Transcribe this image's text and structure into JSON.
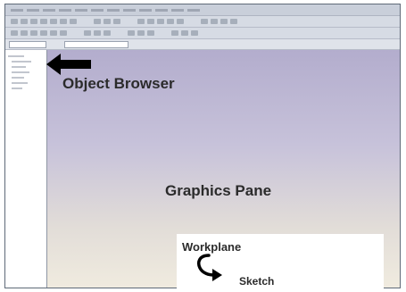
{
  "annotations": {
    "object_browser": "Object Browser",
    "graphics_pane": "Graphics Pane",
    "workplane": "Workplane",
    "sketch": "Sketch"
  },
  "icons": {
    "pointer": "arrow-left-icon",
    "transition": "curved-arrow-icon"
  },
  "colors": {
    "annotation_text": "#2b2b2b",
    "graphics_top": "#b3adcd",
    "graphics_bottom": "#f0ebdf"
  }
}
